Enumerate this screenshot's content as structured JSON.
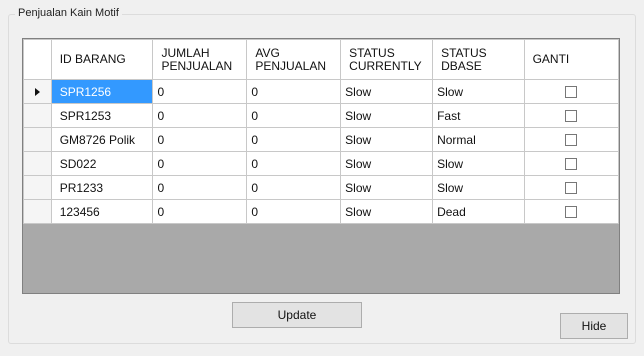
{
  "groupbox": {
    "title": "Penjualan Kain Motif"
  },
  "grid": {
    "columns": [
      "ID BARANG",
      "JUMLAH\nPENJUALAN",
      "AVG\nPENJUALAN",
      "STATUS\nCURRENTLY",
      "STATUS\nDBASE",
      "GANTI"
    ],
    "rows": [
      {
        "id": "SPR1256",
        "jumlah": "0",
        "avg": "0",
        "current": "Slow",
        "dbase": "Slow",
        "ganti": false,
        "selected": true
      },
      {
        "id": "SPR1253",
        "jumlah": "0",
        "avg": "0",
        "current": "Slow",
        "dbase": "Fast",
        "ganti": false,
        "selected": false
      },
      {
        "id": "GM8726 Polik",
        "jumlah": "0",
        "avg": "0",
        "current": "Slow",
        "dbase": "Normal",
        "ganti": false,
        "selected": false
      },
      {
        "id": "SD022",
        "jumlah": "0",
        "avg": "0",
        "current": "Slow",
        "dbase": "Slow",
        "ganti": false,
        "selected": false
      },
      {
        "id": "PR1233",
        "jumlah": "0",
        "avg": "0",
        "current": "Slow",
        "dbase": "Slow",
        "ganti": false,
        "selected": false
      },
      {
        "id": "123456",
        "jumlah": "0",
        "avg": "0",
        "current": "Slow",
        "dbase": "Dead",
        "ganti": false,
        "selected": false
      }
    ]
  },
  "buttons": {
    "update": "Update",
    "hide": "Hide"
  },
  "icons": {
    "current_row": "row-pointer-icon"
  }
}
